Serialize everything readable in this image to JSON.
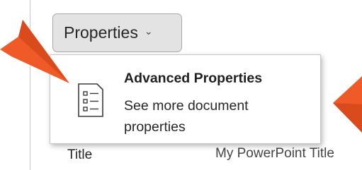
{
  "properties_button": {
    "label": "Properties",
    "chevron": "⌄"
  },
  "dropdown": {
    "items": [
      {
        "icon": "property-list-icon",
        "title": "Advanced Properties",
        "description": "See more document properties"
      }
    ]
  },
  "property_row": {
    "label": "Title",
    "value": "My PowerPoint Title"
  },
  "colors": {
    "callout_arrow": "#f05a28",
    "button_bg": "#e3e3e3"
  }
}
